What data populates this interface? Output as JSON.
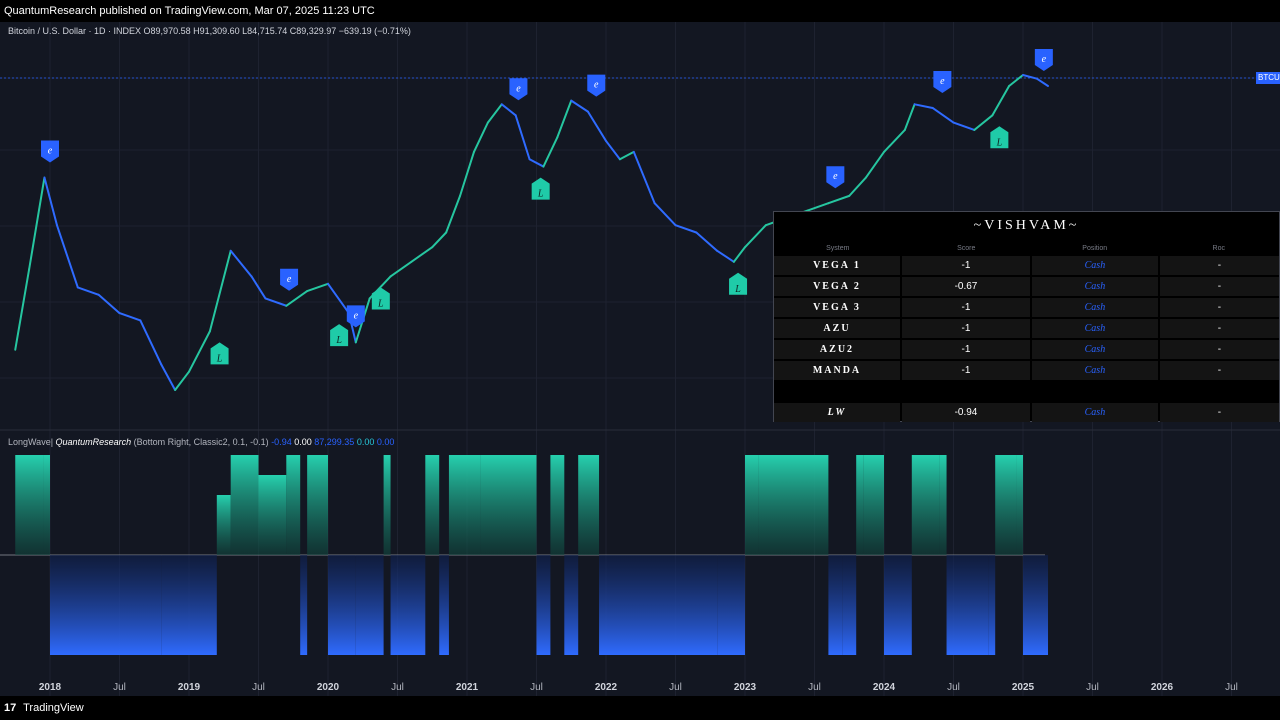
{
  "header": {
    "publisher": "QuantumResearch published on TradingView.com, Mar 07, 2025 11:23 UTC"
  },
  "footer": {
    "logo": "17",
    "brand": "TradingView"
  },
  "symbol": {
    "name": "Bitcoin / U.S. Dollar · 1D · INDEX",
    "open": "O89,970.58",
    "high": "H91,309.60",
    "low": "L84,715.74",
    "close": "C89,329.97",
    "change": "−639.19 (−0.71%)",
    "price_tag": "BTCUSD"
  },
  "indicator": {
    "name": "LongWave|",
    "author": "QuantumResearch",
    "params": "(Bottom Right, Classic2, 0.1, -0.1)",
    "v1": "-0.94",
    "v2": "0.00",
    "v3": "87,299.35",
    "v4": "0.00",
    "v5": "0.00"
  },
  "colors": {
    "background": "#131722",
    "bull": "#26c6a0",
    "bear": "#2f6bff",
    "signal_long": "#1fcba8",
    "signal_exit": "#2962ff"
  },
  "dashboard": {
    "title": "~VISHVAM~",
    "headers": [
      "System",
      "Score",
      "Position",
      "Roc"
    ],
    "rows": [
      {
        "system": "VEGA 1",
        "score": "-1",
        "position": "Cash",
        "roc": "-"
      },
      {
        "system": "VEGA 2",
        "score": "-0.67",
        "position": "Cash",
        "roc": "-"
      },
      {
        "system": "VEGA 3",
        "score": "-1",
        "position": "Cash",
        "roc": "-"
      },
      {
        "system": "AZU",
        "score": "-1",
        "position": "Cash",
        "roc": "-"
      },
      {
        "system": "AZU2",
        "score": "-1",
        "position": "Cash",
        "roc": "-"
      },
      {
        "system": "MANDA",
        "score": "-1",
        "position": "Cash",
        "roc": "-"
      }
    ],
    "total": {
      "system": "LW",
      "score": "-0.94",
      "position": "Cash",
      "roc": "-"
    }
  },
  "chart_data": [
    {
      "type": "line",
      "x_ticks": [
        "2018",
        "Jul",
        "2019",
        "Jul",
        "2020",
        "Jul",
        "2021",
        "Jul",
        "2022",
        "Jul",
        "2023",
        "Jul",
        "2024",
        "Jul",
        "2025",
        "Jul",
        "2026",
        "Jul"
      ],
      "x": [
        2017.75,
        2017.85,
        2017.96,
        2018.05,
        2018.2,
        2018.35,
        2018.5,
        2018.65,
        2018.8,
        2018.9,
        2019.0,
        2019.15,
        2019.3,
        2019.45,
        2019.55,
        2019.7,
        2019.85,
        2020.0,
        2020.15,
        2020.2,
        2020.3,
        2020.45,
        2020.6,
        2020.75,
        2020.85,
        2020.95,
        2021.05,
        2021.15,
        2021.25,
        2021.35,
        2021.45,
        2021.55,
        2021.65,
        2021.75,
        2021.87,
        2022.0,
        2022.1,
        2022.2,
        2022.35,
        2022.5,
        2022.65,
        2022.8,
        2022.92,
        2023.0,
        2023.15,
        2023.3,
        2023.45,
        2023.6,
        2023.75,
        2023.87,
        2024.0,
        2024.15,
        2024.22,
        2024.35,
        2024.5,
        2024.65,
        2024.78,
        2024.9,
        2025.0,
        2025.1,
        2025.18
      ],
      "series": [
        {
          "values": [
            0.28,
            0.5,
            0.75,
            0.62,
            0.45,
            0.43,
            0.38,
            0.36,
            0.24,
            0.17,
            0.22,
            0.33,
            0.55,
            0.48,
            0.42,
            0.4,
            0.44,
            0.46,
            0.38,
            0.3,
            0.42,
            0.48,
            0.52,
            0.56,
            0.6,
            0.7,
            0.82,
            0.9,
            0.95,
            0.92,
            0.8,
            0.78,
            0.86,
            0.96,
            0.93,
            0.85,
            0.8,
            0.82,
            0.68,
            0.62,
            0.6,
            0.55,
            0.52,
            0.56,
            0.62,
            0.64,
            0.66,
            0.68,
            0.7,
            0.75,
            0.82,
            0.88,
            0.95,
            0.94,
            0.9,
            0.88,
            0.92,
            1.0,
            1.03,
            1.02,
            1.0
          ]
        }
      ],
      "signals_exit": [
        {
          "x": 2018.0,
          "label": "e"
        },
        {
          "x": 2019.72,
          "label": "e"
        },
        {
          "x": 2020.2,
          "label": "e"
        },
        {
          "x": 2021.37,
          "label": "e"
        },
        {
          "x": 2021.93,
          "label": "e"
        },
        {
          "x": 2023.65,
          "label": "e"
        },
        {
          "x": 2024.42,
          "label": "e"
        },
        {
          "x": 2025.15,
          "label": "e"
        }
      ],
      "signals_long": [
        {
          "x": 2019.22,
          "label": "L"
        },
        {
          "x": 2020.08,
          "label": "L"
        },
        {
          "x": 2020.38,
          "label": "L"
        },
        {
          "x": 2021.53,
          "label": "L"
        },
        {
          "x": 2022.95,
          "label": "L"
        },
        {
          "x": 2024.83,
          "label": "L"
        }
      ]
    },
    {
      "type": "area",
      "name": "LongWave",
      "x": [
        2017.75,
        2017.95,
        2018.0,
        2018.8,
        2019.2,
        2019.3,
        2019.5,
        2019.7,
        2019.8,
        2019.85,
        2020.0,
        2020.2,
        2020.4,
        2020.45,
        2020.7,
        2020.8,
        2020.87,
        2021.0,
        2021.1,
        2021.5,
        2021.6,
        2021.7,
        2021.8,
        2021.95,
        2022.0,
        2022.5,
        2022.8,
        2023.0,
        2023.1,
        2023.6,
        2023.7,
        2023.8,
        2023.85,
        2024.0,
        2024.2,
        2024.4,
        2024.45,
        2024.75,
        2024.8,
        2024.95,
        2025.0,
        2025.18
      ],
      "values": [
        1,
        1,
        -1,
        -1,
        0.6,
        1,
        0.8,
        1,
        -1,
        1,
        -1,
        -1,
        1,
        -1,
        1,
        -1,
        1,
        1,
        1,
        -1,
        1,
        -1,
        1,
        -1,
        -1,
        -1,
        -1,
        1,
        1,
        -1,
        -1,
        1,
        1,
        -1,
        1,
        1,
        -1,
        -1,
        1,
        1,
        -1,
        -1
      ],
      "ylim": [
        -1,
        1
      ]
    }
  ]
}
